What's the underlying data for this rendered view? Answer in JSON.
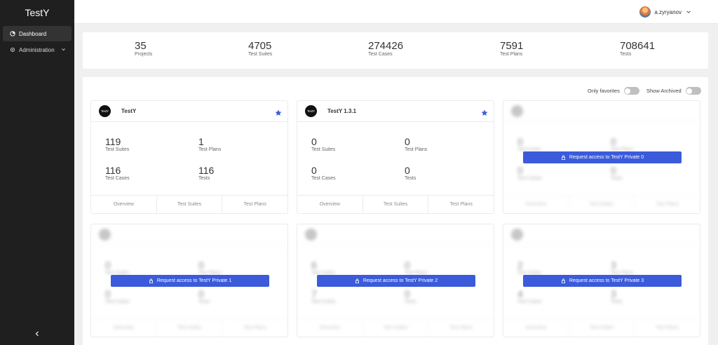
{
  "app": {
    "title": "TestY"
  },
  "sidebar": {
    "items": [
      {
        "label": "Dashboard",
        "icon": "dashboard-icon"
      },
      {
        "label": "Administration",
        "icon": "gear-icon"
      }
    ],
    "collapse_icon": "chevron-left-icon"
  },
  "header": {
    "username": "a.zyryanov"
  },
  "stats": [
    {
      "value": "35",
      "label": "Projects"
    },
    {
      "value": "4705",
      "label": "Test Suites"
    },
    {
      "value": "274426",
      "label": "Test Cases"
    },
    {
      "value": "7591",
      "label": "Test Plans"
    },
    {
      "value": "708641",
      "label": "Tests"
    }
  ],
  "filters": {
    "only_favorites": "Only favorites",
    "show_archived": "Show Archived"
  },
  "accent_color": "#3b5bdb",
  "cards": [
    {
      "title": "TestY",
      "logo": "TestY",
      "suites": "119",
      "suites_label": "Test Suites",
      "plans": "1",
      "plans_label": "Test Plans",
      "cases": "116",
      "cases_label": "Test Cases",
      "tests": "116",
      "tests_label": "Tests",
      "links": [
        "Overview",
        "Test Suites",
        "Test Plans"
      ]
    },
    {
      "title": "TestY 1.3.1",
      "logo": "TestY",
      "suites": "0",
      "suites_label": "Test Suites",
      "plans": "0",
      "plans_label": "Test Plans",
      "cases": "0",
      "cases_label": "Test Cases",
      "tests": "0",
      "tests_label": "Tests",
      "links": [
        "Overview",
        "Test Suites",
        "Test Plans"
      ]
    },
    {
      "title": "",
      "request": "Request access to TestY Private 0",
      "suites": "0",
      "plans": "0",
      "cases": "0",
      "tests": "0"
    },
    {
      "title": "",
      "request": "Request access to TestY Private 1",
      "suites": "0",
      "plans": "0",
      "cases": "0",
      "tests": "0"
    },
    {
      "title": "",
      "request": "Request access to TestY Private 2",
      "suites": "6",
      "plans": "0",
      "cases": "7",
      "tests": "0"
    },
    {
      "title": "",
      "request": "Request access to TestY Private 3",
      "suites": "2",
      "plans": "3",
      "cases": "4",
      "tests": "3"
    }
  ]
}
